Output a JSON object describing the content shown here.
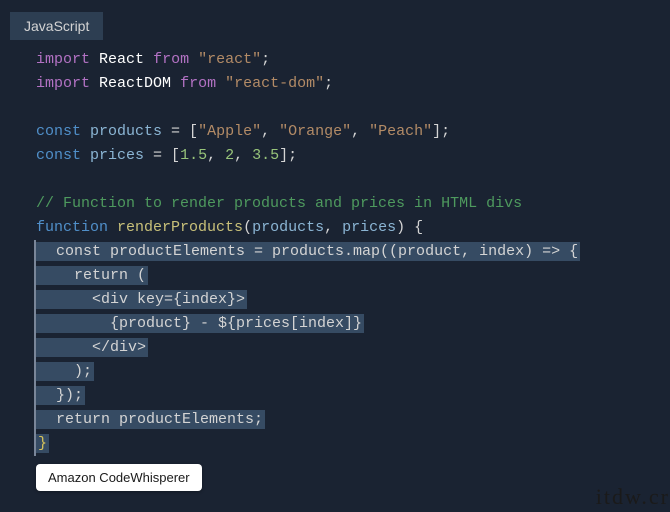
{
  "tab": {
    "label": "JavaScript"
  },
  "code": {
    "l1": {
      "kw": "import",
      "name": "React",
      "from": "from",
      "str": "\"react\"",
      "semi": ";"
    },
    "l2": {
      "kw": "import",
      "name": "ReactDOM",
      "from": "from",
      "str": "\"react-dom\"",
      "semi": ";"
    },
    "l3": "",
    "l4": {
      "kw": "const",
      "name": "products",
      "eq": " = [",
      "s1": "\"Apple\"",
      "c1": ", ",
      "s2": "\"Orange\"",
      "c2": ", ",
      "s3": "\"Peach\"",
      "end": "];"
    },
    "l5": {
      "kw": "const",
      "name": "prices",
      "eq": " = [",
      "n1": "1.5",
      "c1": ", ",
      "n2": "2",
      "c2": ", ",
      "n3": "3.5",
      "end": "];"
    },
    "l6": "",
    "l7": "// Function to render products and prices in HTML divs",
    "l8": {
      "kw": "function",
      "fn": "renderProducts",
      "open": "(",
      "p1": "products",
      "c": ", ",
      "p2": "prices",
      "close": ") {"
    },
    "l9": "  const productElements = products.map((product, index) => {",
    "l10_a": "    return (",
    "l11": "      <div key={index}>",
    "l12": "        {product} - ${prices[index]}",
    "l13": "      </div>",
    "l14": "    );",
    "l15": "  });",
    "l16": "  return productElements;",
    "l17": "}"
  },
  "badge": {
    "label": "Amazon CodeWhisperer"
  },
  "watermark": "itdw.cr"
}
